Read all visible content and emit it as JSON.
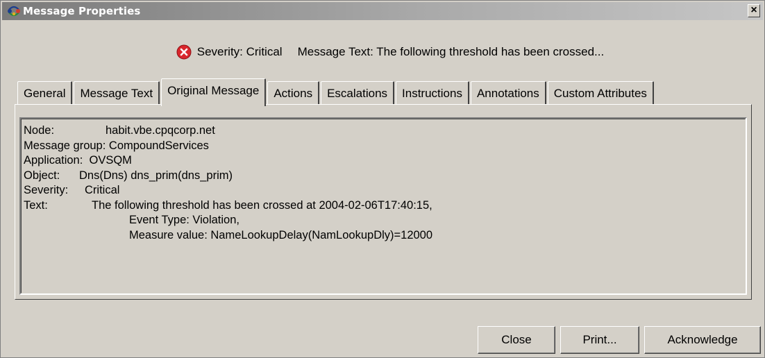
{
  "window": {
    "title": "Message Properties",
    "close_glyph": "×",
    "app_icon": "network-nodes-icon"
  },
  "summary": {
    "severity_icon": "critical-error-icon",
    "severity_text": "Severity: Critical",
    "message_text": "Message Text: The following threshold has been crossed..."
  },
  "tabs": [
    {
      "label": "General"
    },
    {
      "label": "Message Text"
    },
    {
      "label": "Original Message",
      "active": true
    },
    {
      "label": "Actions"
    },
    {
      "label": "Escalations"
    },
    {
      "label": "Instructions"
    },
    {
      "label": "Annotations"
    },
    {
      "label": "Custom Attributes"
    }
  ],
  "original_message": {
    "node_label": "Node:",
    "node_value": "habit.vbe.cpqcorp.net",
    "group_label": "Message group:",
    "group_value": "CompoundServices",
    "application_label": "Application:",
    "application_value": "OVSQM",
    "object_label": "Object:",
    "object_value": "Dns(Dns) dns_prim(dns_prim)",
    "severity_label": "Severity:",
    "severity_value": "Critical",
    "text_label": "Text:",
    "text_line1": "The following threshold has been crossed at 2004-02-06T17:40:15,",
    "text_line2": "Event Type: Violation,",
    "text_line3": "Measure value: NameLookupDelay(NamLookupDly)=12000"
  },
  "buttons": {
    "close": "Close",
    "print": "Print...",
    "acknowledge": "Acknowledge"
  },
  "colors": {
    "dialog_bg": "#d4d0c8",
    "severity_red": "#d9262c"
  }
}
